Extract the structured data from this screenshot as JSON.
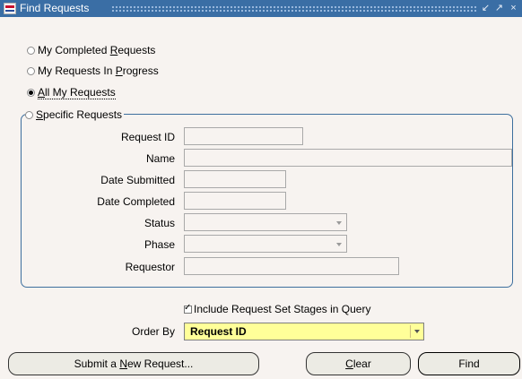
{
  "window": {
    "title": "Find Requests",
    "controls": [
      "↙",
      "↗",
      "×"
    ]
  },
  "radios": [
    {
      "label_pre": "My Completed ",
      "label_key": "R",
      "label_post": "equests",
      "selected": false
    },
    {
      "label_pre": "My Requests In ",
      "label_key": "P",
      "label_post": "rogress",
      "selected": false
    },
    {
      "label_pre": "",
      "label_key": "A",
      "label_post": "ll My Requests",
      "selected": true
    }
  ],
  "specific": {
    "label_pre": "",
    "label_key": "S",
    "label_post": "pecific Requests",
    "fields": {
      "request_id": {
        "label": "Request ID",
        "value": ""
      },
      "name": {
        "label": "Name",
        "value": ""
      },
      "date_submitted": {
        "label": "Date Submitted",
        "value": ""
      },
      "date_completed": {
        "label": "Date Completed",
        "value": ""
      },
      "status": {
        "label": "Status",
        "value": ""
      },
      "phase": {
        "label": "Phase",
        "value": ""
      },
      "requestor": {
        "label": "Requestor",
        "value": ""
      }
    }
  },
  "include_stages": {
    "label": "Include Request Set Stages in Query",
    "checked": true
  },
  "order_by": {
    "label": "Order By",
    "value": "Request ID"
  },
  "buttons": {
    "submit": {
      "pre": "Submit a ",
      "key": "N",
      "post": "ew Request..."
    },
    "clear": {
      "pre": "",
      "key": "C",
      "post": "lear"
    },
    "find": {
      "label": "Find"
    }
  }
}
